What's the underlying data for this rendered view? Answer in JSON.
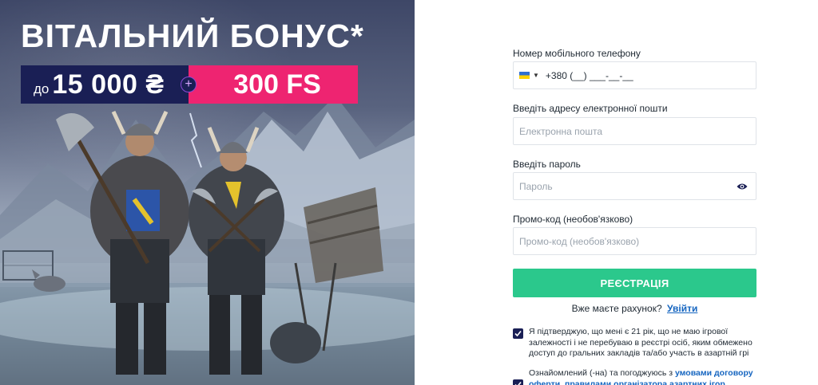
{
  "banner": {
    "title": "ВІТАЛЬНИЙ БОНУС*",
    "bonus_prefix": "до",
    "bonus_amount": "15 000 ₴",
    "plus_symbol": "+",
    "bonus_spins": "300 FS",
    "colors": {
      "amount_bg": "#1a1f55",
      "spins_bg": "#ee2471"
    }
  },
  "form": {
    "phone": {
      "label": "Номер мобільного телефону",
      "country_icon": "ukraine-flag-icon",
      "value": "+380 (__) ___-__-__"
    },
    "email": {
      "label": "Введіть адресу електронної пошти",
      "placeholder": "Електронна пошта"
    },
    "password": {
      "label": "Введіть пароль",
      "placeholder": "Пароль",
      "toggle_icon": "eye-icon"
    },
    "promo": {
      "label": "Промо-код (необов'язково)",
      "placeholder": "Промо-код (необов'язково)"
    },
    "submit_label": "РЕЄСТРАЦІЯ",
    "login_prompt": "Вже маєте рахунок?",
    "login_link": "Увійти",
    "consent_age": "Я підтверджую, що мені є 21 рік, що не маю ігрової залежності і не перебуваю в реєстрі осіб, яким обмежено доступ до гральних закладів та/або участь в азартній грі",
    "consent_terms_prefix": "Ознайомлений (-на) та погоджуюсь з",
    "consent_terms_link": "умовами договору оферти, правилами організатора азартних ігор, політикою",
    "colors": {
      "submit_bg": "#2bc88c",
      "link": "#1565c0",
      "checkbox": "#1a1f55"
    }
  }
}
